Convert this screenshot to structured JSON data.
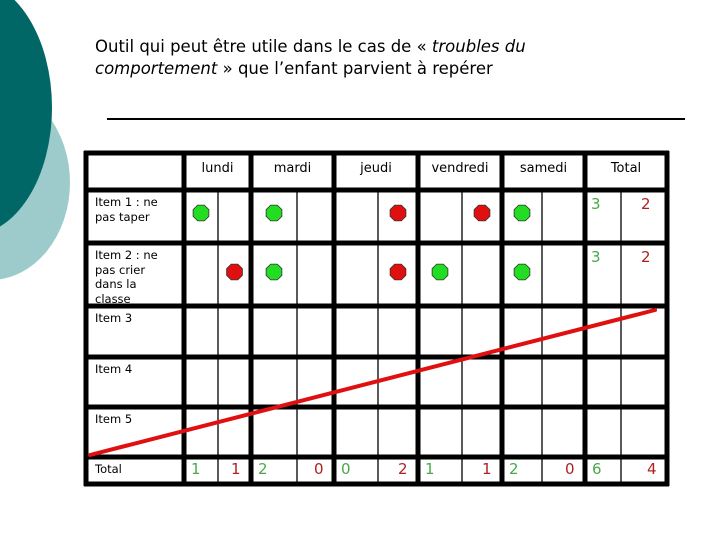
{
  "title": {
    "part1": "Outil qui peut être utile dans le cas de « ",
    "italic1": "troubles du",
    "part2_italic": "comportement",
    "part2": " » que l’enfant parvient à repérer"
  },
  "colors": {
    "accent_dark": "#006666",
    "accent_light": "#9dcbcb",
    "green_token": "#22dd22",
    "red_token": "#e01010",
    "green_number": "#4aa84a",
    "red_number": "#b02020",
    "strike_line": "#e01010"
  },
  "table": {
    "headers": [
      "",
      "lundi",
      "mardi",
      "jeudi",
      "vendredi",
      "samedi",
      "Total"
    ],
    "rows": [
      {
        "label": "Item 1 : ne pas taper",
        "marks": [
          [
            "green",
            null
          ],
          [
            "green",
            null
          ],
          [
            null,
            "red"
          ],
          [
            null,
            "red"
          ],
          [
            "green",
            null
          ]
        ],
        "total": {
          "green": "3",
          "red": "2"
        }
      },
      {
        "label": "Item 2 : ne pas crier dans la classe",
        "marks": [
          [
            null,
            "red"
          ],
          [
            "green",
            null
          ],
          [
            null,
            "red"
          ],
          [
            "green",
            null
          ],
          [
            "green",
            null
          ]
        ],
        "total": {
          "green": "3",
          "red": "2"
        }
      },
      {
        "label": "Item 3",
        "marks": [
          [
            null,
            null
          ],
          [
            null,
            null
          ],
          [
            null,
            null
          ],
          [
            null,
            null
          ],
          [
            null,
            null
          ]
        ],
        "total": {
          "green": "",
          "red": ""
        }
      },
      {
        "label": "Item 4",
        "marks": [
          [
            null,
            null
          ],
          [
            null,
            null
          ],
          [
            null,
            null
          ],
          [
            null,
            null
          ],
          [
            null,
            null
          ]
        ],
        "total": {
          "green": "",
          "red": ""
        }
      },
      {
        "label": "Item 5",
        "marks": [
          [
            null,
            null
          ],
          [
            null,
            null
          ],
          [
            null,
            null
          ],
          [
            null,
            null
          ],
          [
            null,
            null
          ]
        ],
        "total": {
          "green": "",
          "red": ""
        }
      }
    ],
    "totals_row": {
      "label": "Total",
      "values": [
        {
          "green": "1",
          "red": "1"
        },
        {
          "green": "2",
          "red": "0"
        },
        {
          "green": "0",
          "red": "2"
        },
        {
          "green": "1",
          "red": "1"
        },
        {
          "green": "2",
          "red": "0"
        },
        {
          "green": "6",
          "red": "4"
        }
      ]
    },
    "strike_note": "empty items crossed out"
  }
}
